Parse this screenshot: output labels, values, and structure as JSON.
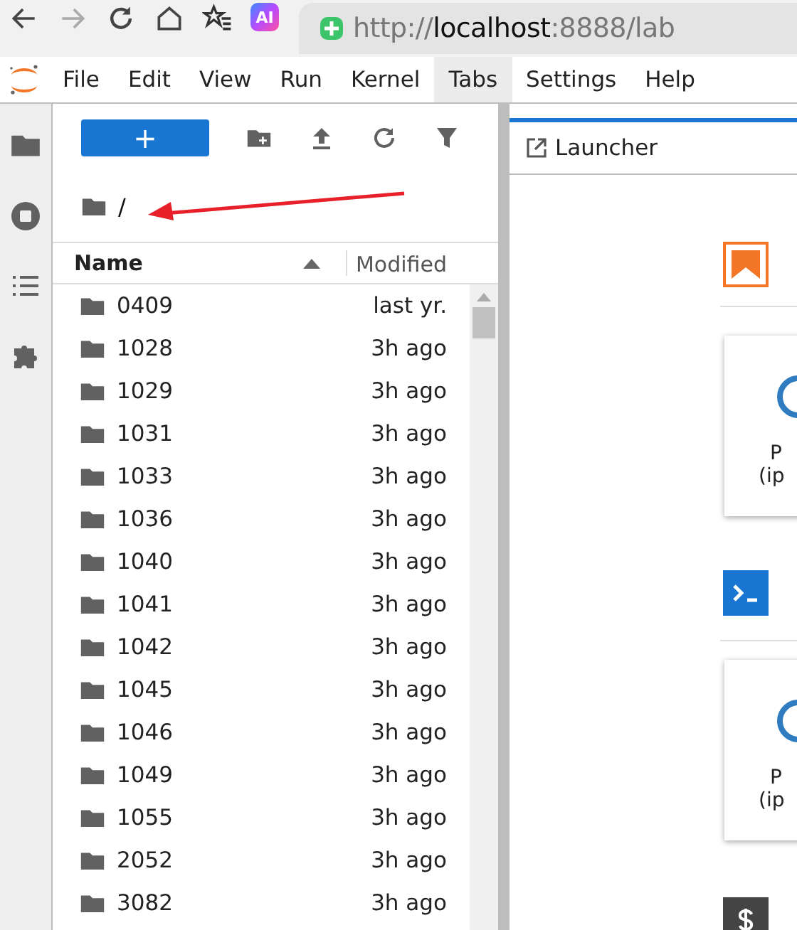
{
  "browser": {
    "url_scheme": "http://",
    "url_host": "localhost",
    "url_rest": ":8888/lab",
    "ai_badge": "AI"
  },
  "menu": [
    {
      "label": "File",
      "selected": false
    },
    {
      "label": "Edit",
      "selected": false
    },
    {
      "label": "View",
      "selected": false
    },
    {
      "label": "Run",
      "selected": false
    },
    {
      "label": "Kernel",
      "selected": false
    },
    {
      "label": "Tabs",
      "selected": true
    },
    {
      "label": "Settings",
      "selected": false
    },
    {
      "label": "Help",
      "selected": false
    }
  ],
  "file_browser": {
    "new_button": "+",
    "breadcrumb": "/",
    "columns": [
      {
        "label": "Name",
        "sorted": true
      },
      {
        "label": "Modified",
        "sorted": false
      }
    ],
    "rows": [
      {
        "name": "0409",
        "modified": "last yr."
      },
      {
        "name": "1028",
        "modified": "3h ago"
      },
      {
        "name": "1029",
        "modified": "3h ago"
      },
      {
        "name": "1031",
        "modified": "3h ago"
      },
      {
        "name": "1033",
        "modified": "3h ago"
      },
      {
        "name": "1036",
        "modified": "3h ago"
      },
      {
        "name": "1040",
        "modified": "3h ago"
      },
      {
        "name": "1041",
        "modified": "3h ago"
      },
      {
        "name": "1042",
        "modified": "3h ago"
      },
      {
        "name": "1045",
        "modified": "3h ago"
      },
      {
        "name": "1046",
        "modified": "3h ago"
      },
      {
        "name": "1049",
        "modified": "3h ago"
      },
      {
        "name": "1055",
        "modified": "3h ago"
      },
      {
        "name": "2052",
        "modified": "3h ago"
      },
      {
        "name": "3082",
        "modified": "3h ago"
      }
    ]
  },
  "launcher": {
    "tab": "Launcher",
    "cards": [
      {
        "line_1": "P",
        "line_2": "(ip"
      },
      {
        "line_1": "P",
        "line_2": "(ip"
      }
    ]
  }
}
